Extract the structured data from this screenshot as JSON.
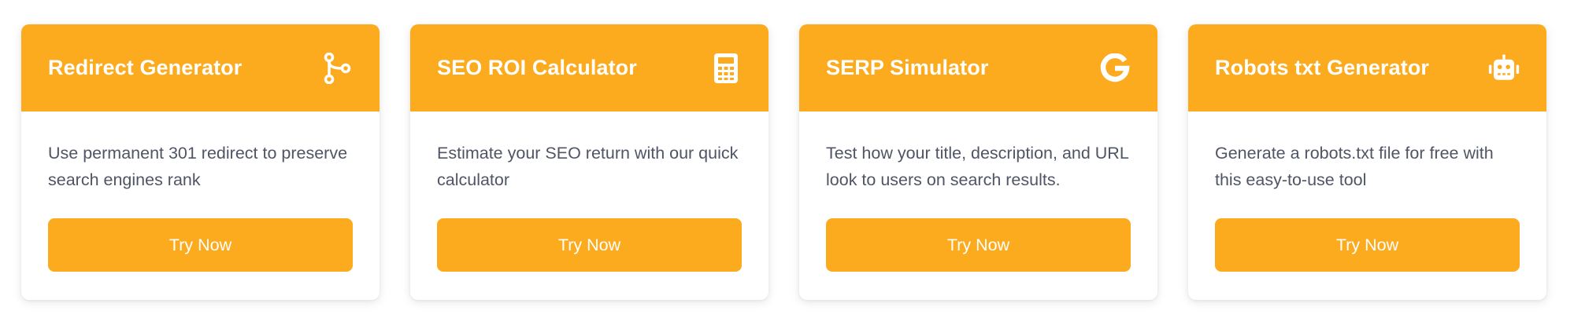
{
  "colors": {
    "accent": "#fdab1e",
    "text": "#4f5564",
    "header_text": "#ffffff"
  },
  "cards": [
    {
      "title": "Redirect Generator",
      "icon": "git-branch-icon",
      "description": "Use permanent 301 redirect to preserve search engines rank",
      "button_label": "Try Now"
    },
    {
      "title": "SEO ROI Calculator",
      "icon": "calculator-icon",
      "description": "Estimate your SEO return with our quick calculator",
      "button_label": "Try Now"
    },
    {
      "title": "SERP Simulator",
      "icon": "google-icon",
      "description": "Test how your title, description, and URL look to users on search results.",
      "button_label": "Try Now"
    },
    {
      "title": "Robots txt Generator",
      "icon": "robot-icon",
      "description": "Generate a robots.txt file for free with this easy-to-use tool",
      "button_label": "Try Now"
    }
  ]
}
